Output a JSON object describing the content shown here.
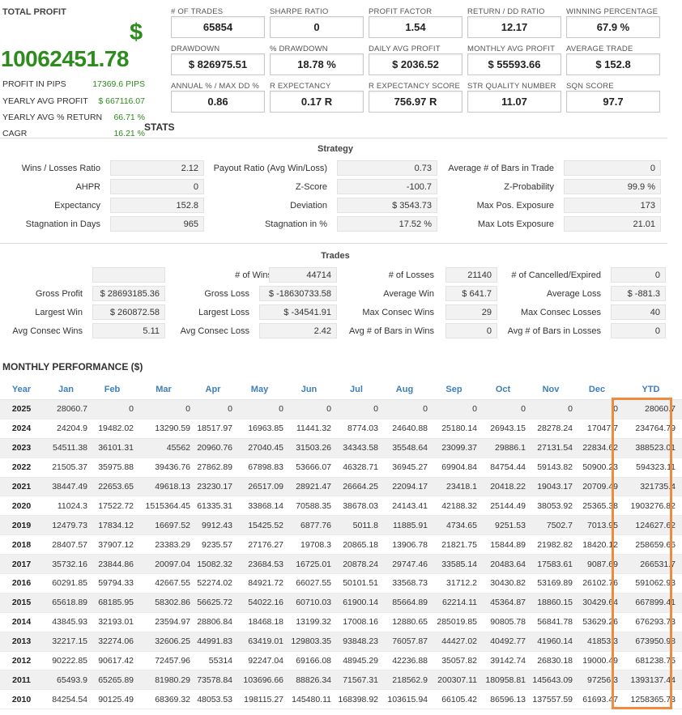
{
  "summary": {
    "total_profit_label": "TOTAL PROFIT",
    "currency_symbol": "$",
    "total_profit_value": "10062451.78",
    "rows": [
      {
        "label": "PROFIT IN PIPS",
        "value": "17369.6 PIPS"
      },
      {
        "label": "YEARLY AVG PROFIT",
        "value": "$ 667116.07"
      },
      {
        "label": "YEARLY AVG % RETURN",
        "value": "66.71 %"
      },
      {
        "label": "CAGR",
        "value": "16.21 %"
      }
    ]
  },
  "metrics": [
    {
      "label": "# OF TRADES",
      "value": "65854"
    },
    {
      "label": "SHARPE RATIO",
      "value": "0"
    },
    {
      "label": "PROFIT FACTOR",
      "value": "1.54"
    },
    {
      "label": "RETURN / DD RATIO",
      "value": "12.17"
    },
    {
      "label": "WINNING PERCENTAGE",
      "value": "67.9 %"
    },
    {
      "label": "DRAWDOWN",
      "value": "$ 826975.51"
    },
    {
      "label": "% DRAWDOWN",
      "value": "18.78 %"
    },
    {
      "label": "DAILY AVG PROFIT",
      "value": "$ 2036.52"
    },
    {
      "label": "MONTHLY AVG PROFIT",
      "value": "$ 55593.66"
    },
    {
      "label": "AVERAGE TRADE",
      "value": "$ 152.8"
    },
    {
      "label": "ANNUAL % / MAX DD %",
      "value": "0.86"
    },
    {
      "label": "R EXPECTANCY",
      "value": "0.17 R"
    },
    {
      "label": "R EXPECTANCY SCORE",
      "value": "756.97 R"
    },
    {
      "label": "STR QUALITY NUMBER",
      "value": "11.07"
    },
    {
      "label": "SQN SCORE",
      "value": "97.7"
    }
  ],
  "stats_title": "STATS",
  "strategy": {
    "title": "Strategy",
    "rows": [
      [
        {
          "label": "Wins / Losses Ratio",
          "value": "2.12"
        },
        {
          "label": "Payout Ratio (Avg Win/Loss)",
          "value": "0.73"
        },
        {
          "label": "Average # of Bars in Trade",
          "value": "0"
        }
      ],
      [
        {
          "label": "AHPR",
          "value": "0"
        },
        {
          "label": "Z-Score",
          "value": "-100.7"
        },
        {
          "label": "Z-Probability",
          "value": "99.9 %"
        }
      ],
      [
        {
          "label": "Expectancy",
          "value": "152.8"
        },
        {
          "label": "Deviation",
          "value": "$ 3543.73"
        },
        {
          "label": "Max Pos. Exposure",
          "value": "173"
        }
      ],
      [
        {
          "label": "Stagnation in Days",
          "value": "965"
        },
        {
          "label": "Stagnation in %",
          "value": "17.52 %"
        },
        {
          "label": "Max Lots Exposure",
          "value": "21.01"
        }
      ]
    ]
  },
  "trades": {
    "title": "Trades",
    "rows": [
      [
        {
          "label": "",
          "value": ""
        },
        {
          "label": "# of Wins",
          "value": "44714"
        },
        {
          "label": "# of Losses",
          "value": "21140"
        },
        {
          "label": "# of Cancelled/Expired",
          "value": "0"
        }
      ],
      [
        {
          "label": "Gross Profit",
          "value": "$ 28693185.36"
        },
        {
          "label": "Gross Loss",
          "value": "$ -18630733.58"
        },
        {
          "label": "Average Win",
          "value": "$ 641.7"
        },
        {
          "label": "Average Loss",
          "value": "$ -881.3"
        }
      ],
      [
        {
          "label": "Largest Win",
          "value": "$ 260872.58"
        },
        {
          "label": "Largest Loss",
          "value": "$ -34541.91"
        },
        {
          "label": "Max Consec Wins",
          "value": "29"
        },
        {
          "label": "Max Consec Losses",
          "value": "40"
        }
      ],
      [
        {
          "label": "Avg Consec Wins",
          "value": "5.11"
        },
        {
          "label": "Avg Consec Loss",
          "value": "2.42"
        },
        {
          "label": "Avg # of Bars in Wins",
          "value": "0"
        },
        {
          "label": "Avg # of Bars in Losses",
          "value": "0"
        }
      ]
    ]
  },
  "monthly": {
    "title": "MONTHLY PERFORMANCE ($)",
    "headers": [
      "Year",
      "Jan",
      "Feb",
      "Mar",
      "Apr",
      "May",
      "Jun",
      "Jul",
      "Aug",
      "Sep",
      "Oct",
      "Nov",
      "Dec",
      "YTD"
    ],
    "rows": [
      [
        "2025",
        "28060.7",
        "0",
        "0",
        "0",
        "0",
        "0",
        "0",
        "0",
        "0",
        "0",
        "0",
        "0",
        "28060.7"
      ],
      [
        "2024",
        "24204.9",
        "19482.02",
        "13290.59",
        "18517.97",
        "16963.85",
        "11441.32",
        "8774.03",
        "24640.88",
        "25180.14",
        "26943.15",
        "28278.24",
        "17047.7",
        "234764.79"
      ],
      [
        "2023",
        "54511.38",
        "36101.31",
        "45562",
        "20960.76",
        "27040.45",
        "31503.26",
        "34343.58",
        "35548.64",
        "23099.37",
        "29886.1",
        "27131.54",
        "22834.62",
        "388523.01"
      ],
      [
        "2022",
        "21505.37",
        "35975.88",
        "39436.76",
        "27862.89",
        "67898.83",
        "53666.07",
        "46328.71",
        "36945.27",
        "69904.84",
        "84754.44",
        "59143.82",
        "50900.23",
        "594323.11"
      ],
      [
        "2021",
        "38447.49",
        "22653.65",
        "49618.13",
        "23230.17",
        "26517.09",
        "28921.47",
        "26664.25",
        "22094.17",
        "23418.1",
        "20418.22",
        "19043.17",
        "20709.49",
        "321735.4"
      ],
      [
        "2020",
        "11024.3",
        "17522.72",
        "1515364.45",
        "61335.31",
        "33868.14",
        "70588.35",
        "38678.03",
        "24143.41",
        "42188.32",
        "25144.49",
        "38053.92",
        "25365.38",
        "1903276.82"
      ],
      [
        "2019",
        "12479.73",
        "17834.12",
        "16697.52",
        "9912.43",
        "15425.52",
        "6877.76",
        "5011.8",
        "11885.91",
        "4734.65",
        "9251.53",
        "7502.7",
        "7013.95",
        "124627.62"
      ],
      [
        "2018",
        "28407.57",
        "37907.12",
        "23383.29",
        "9235.57",
        "27176.27",
        "19708.3",
        "20865.18",
        "13906.78",
        "21821.75",
        "15844.89",
        "21982.82",
        "18420.12",
        "258659.66"
      ],
      [
        "2017",
        "35732.16",
        "23844.86",
        "20097.04",
        "15082.32",
        "23684.53",
        "16725.01",
        "20878.24",
        "29747.46",
        "33585.14",
        "20483.64",
        "17583.61",
        "9087.69",
        "266531.7"
      ],
      [
        "2016",
        "60291.85",
        "59794.33",
        "42667.55",
        "52274.02",
        "84921.72",
        "66027.55",
        "50101.51",
        "33568.73",
        "31712.2",
        "30430.82",
        "53169.89",
        "26102.76",
        "591062.93"
      ],
      [
        "2015",
        "65618.89",
        "68185.95",
        "58302.86",
        "56625.72",
        "54022.16",
        "60710.03",
        "61900.14",
        "85664.89",
        "62214.11",
        "45364.87",
        "18860.15",
        "30429.64",
        "667899.41"
      ],
      [
        "2014",
        "43845.93",
        "32193.01",
        "23594.97",
        "28806.84",
        "18468.18",
        "13199.32",
        "17008.16",
        "12880.65",
        "285019.85",
        "90805.78",
        "56841.78",
        "53629.26",
        "676293.73"
      ],
      [
        "2013",
        "32217.15",
        "32274.06",
        "32606.25",
        "44991.83",
        "63419.01",
        "129803.35",
        "93848.23",
        "76057.87",
        "44427.02",
        "40492.77",
        "41960.14",
        "41853.3",
        "673950.98"
      ],
      [
        "2012",
        "90222.85",
        "90617.42",
        "72457.96",
        "55314",
        "92247.04",
        "69166.08",
        "48945.29",
        "42236.88",
        "35057.82",
        "39142.74",
        "26830.18",
        "19000.49",
        "681238.75"
      ],
      [
        "2011",
        "65493.9",
        "65265.89",
        "81980.29",
        "73578.84",
        "103696.66",
        "88826.34",
        "71567.31",
        "218562.9",
        "200307.11",
        "180958.81",
        "145643.09",
        "97256.3",
        "1393137.44"
      ],
      [
        "2010",
        "84254.54",
        "90125.49",
        "68369.32",
        "48053.53",
        "198115.27",
        "145480.11",
        "168398.92",
        "103615.94",
        "66105.42",
        "86596.13",
        "137557.59",
        "61693.47",
        "1258365.73"
      ]
    ]
  }
}
